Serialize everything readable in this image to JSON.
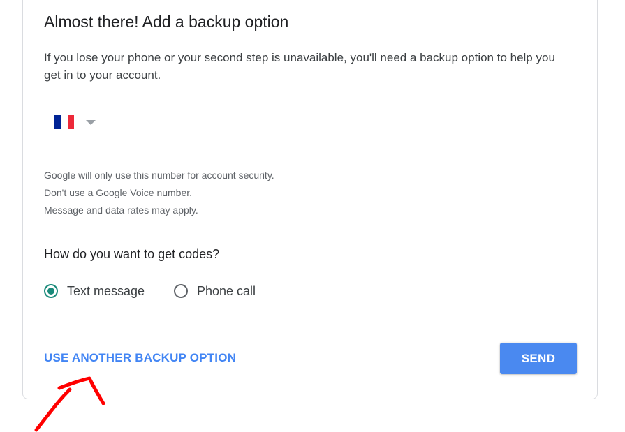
{
  "card": {
    "title": "Almost there! Add a backup option",
    "description": "If you lose your phone or your second step is unavailable, you'll need a backup option to help you get in to your account."
  },
  "phone": {
    "country_flag": "france-flag-icon",
    "flag_colors": [
      "#002395",
      "#ffffff",
      "#ed2939"
    ],
    "placeholder": "",
    "value": ""
  },
  "notes": [
    "Google will only use this number for account security.",
    "Don't use a Google Voice number.",
    "Message and data rates may apply."
  ],
  "codes": {
    "question": "How do you want to get codes?",
    "options": [
      {
        "label": "Text message",
        "selected": true
      },
      {
        "label": "Phone call",
        "selected": false
      }
    ]
  },
  "actions": {
    "alt_option_label": "USE ANOTHER BACKUP OPTION",
    "send_label": "SEND"
  },
  "colors": {
    "accent": "#4285f4",
    "radio_selected": "#1a8a7a",
    "annotation": "#ff0000"
  }
}
